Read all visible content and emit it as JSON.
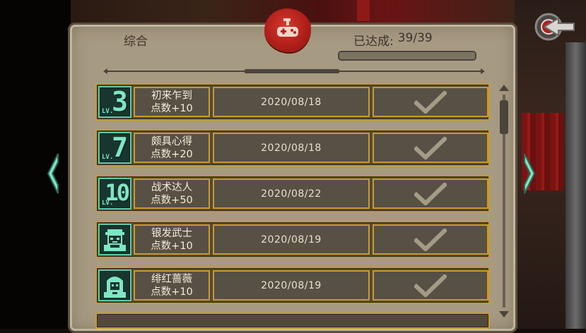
{
  "header": {
    "tab_label": "综合",
    "progress_label": "已达成:",
    "progress_value": "39/39",
    "progress_fraction": 1.0
  },
  "achievements": [
    {
      "badge": "3",
      "badge_prefix": "LV.",
      "badge_icon": "level-badge-icon",
      "title": "初来乍到",
      "reward": "点数+10",
      "date": "2020/08/18",
      "completed": true
    },
    {
      "badge": "7",
      "badge_prefix": "LV.",
      "badge_icon": "level-badge-icon",
      "title": "颇具心得",
      "reward": "点数+20",
      "date": "2020/08/18",
      "completed": true
    },
    {
      "badge": "10",
      "badge_prefix": "LV.",
      "badge_icon": "level-badge-icon",
      "title": "战术达人",
      "reward": "点数+50",
      "date": "2020/08/22",
      "completed": true
    },
    {
      "badge": "",
      "badge_prefix": "",
      "badge_icon": "silver-warrior-portrait-icon",
      "title": "银发武士",
      "reward": "点数+10",
      "date": "2020/08/19",
      "completed": true
    },
    {
      "badge": "",
      "badge_prefix": "",
      "badge_icon": "crimson-rose-portrait-icon",
      "title": "绯红蔷薇",
      "reward": "点数+10",
      "date": "2020/08/19",
      "completed": true
    }
  ],
  "icons": {
    "seal": "gamepad-seal-icon",
    "back": "back-arrow-icon",
    "prev": "chevron-left-icon",
    "next": "chevron-right-icon",
    "check": "checkmark-icon"
  },
  "colors": {
    "panel": "#a79a82",
    "row_border": "#c89b2a",
    "badge_green": "#7fe6c4",
    "seal_red": "#b11f19"
  }
}
